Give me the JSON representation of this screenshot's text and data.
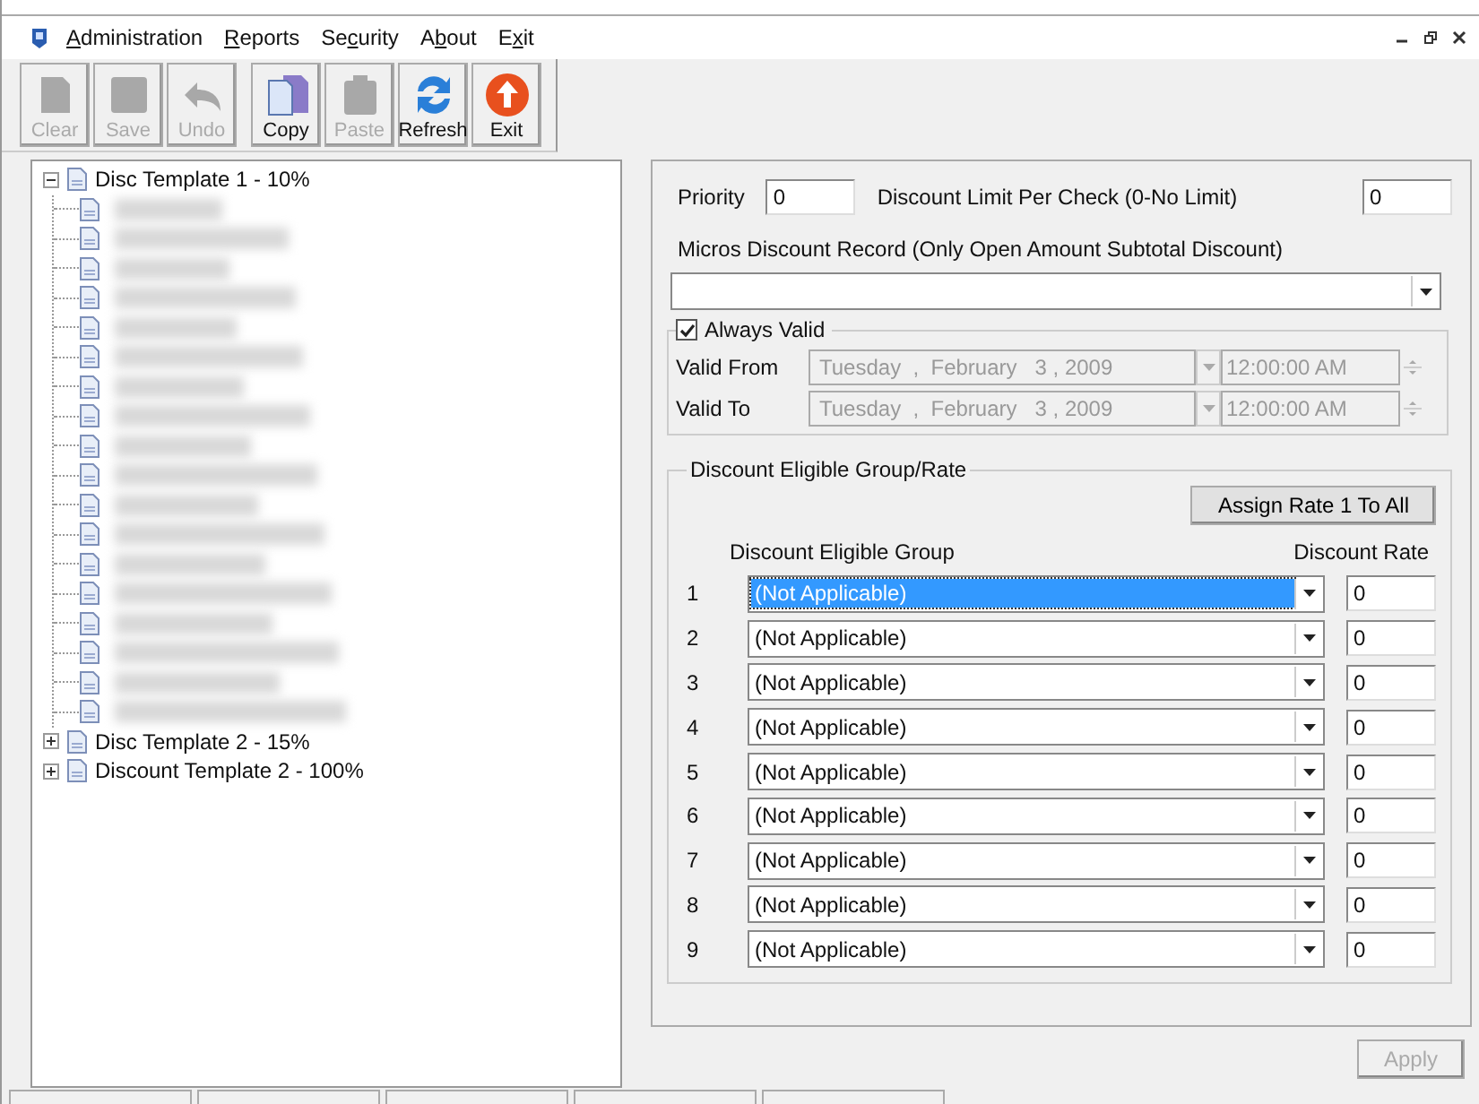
{
  "menu": [
    {
      "access_key": "A",
      "after": "dministration"
    },
    {
      "access_key": "R",
      "after": "eports"
    },
    {
      "before": "Se",
      "access_key": "c",
      "after": "urity"
    },
    {
      "before": "A",
      "access_key": "b",
      "after": "out"
    },
    {
      "before": "E",
      "access_key": "x",
      "after": "it"
    }
  ],
  "toolbar": [
    {
      "label": "Clear",
      "kind": "clear",
      "disabled": true,
      "separator_before": false
    },
    {
      "label": "Save",
      "kind": "save",
      "disabled": true,
      "separator_before": false
    },
    {
      "label": "Undo",
      "kind": "undo",
      "disabled": true,
      "separator_before": false
    },
    {
      "label": "Copy",
      "kind": "copy",
      "disabled": false,
      "separator_before": true
    },
    {
      "label": "Paste",
      "kind": "paste",
      "disabled": true,
      "separator_before": false
    },
    {
      "label": "Refresh",
      "kind": "refresh",
      "disabled": false,
      "separator_before": false
    },
    {
      "label": "Exit",
      "kind": "exit",
      "disabled": false,
      "separator_before": false
    }
  ],
  "tree": [
    {
      "label": "Disc Template 1 - 10%",
      "expanded": true,
      "children": [
        {
          "kind": "redacted"
        },
        {
          "kind": "redacted"
        },
        {
          "kind": "redacted"
        },
        {
          "kind": "redacted"
        },
        {
          "kind": "redacted"
        },
        {
          "kind": "redacted"
        },
        {
          "kind": "redacted"
        },
        {
          "kind": "redacted"
        },
        {
          "kind": "redacted"
        },
        {
          "kind": "redacted"
        },
        {
          "kind": "redacted"
        },
        {
          "kind": "redacted"
        },
        {
          "kind": "redacted"
        },
        {
          "kind": "redacted"
        },
        {
          "kind": "redacted"
        },
        {
          "kind": "redacted"
        },
        {
          "kind": "redacted"
        },
        {
          "kind": "redacted"
        }
      ]
    },
    {
      "label": "Disc Template 2 - 15%",
      "expanded": false
    },
    {
      "label": "Discount Template 2 - 100%",
      "expanded": false
    }
  ],
  "form": {
    "priority_label": "Priority",
    "priority": "0",
    "limit_label": "Discount Limit Per Check (0-No Limit)",
    "limit": "0",
    "record_label": "Micros Discount Record (Only Open Amount Subtotal Discount)",
    "always_valid": {
      "label": "Always Valid",
      "checked": true
    },
    "validity": [
      {
        "label": "Valid From",
        "date": "Tuesday  ,  February   3 , 2009",
        "time": "12:00:00 AM"
      },
      {
        "label": "Valid To",
        "date": "Tuesday  ,  February   3 , 2009",
        "time": "12:00:00 AM"
      }
    ]
  },
  "eligible": {
    "title": "Discount Eligible Group/Rate",
    "assign_button": "Assign Rate 1 To All",
    "group_header": "Discount Eligible Group",
    "rate_header": "Discount Rate",
    "rows": [
      {
        "number": "1",
        "group": "(Not Applicable)",
        "rate": "0",
        "selected": true
      },
      {
        "number": "2",
        "group": "(Not Applicable)",
        "rate": "0",
        "selected": false
      },
      {
        "number": "3",
        "group": "(Not Applicable)",
        "rate": "0",
        "selected": false
      },
      {
        "number": "4",
        "group": "(Not Applicable)",
        "rate": "0",
        "selected": false
      },
      {
        "number": "5",
        "group": "(Not Applicable)",
        "rate": "0",
        "selected": false
      },
      {
        "number": "6",
        "group": "(Not Applicable)",
        "rate": "0",
        "selected": false
      },
      {
        "number": "7",
        "group": "(Not Applicable)",
        "rate": "0",
        "selected": false
      },
      {
        "number": "8",
        "group": "(Not Applicable)",
        "rate": "0",
        "selected": false
      },
      {
        "number": "9",
        "group": "(Not Applicable)",
        "rate": "0",
        "selected": false
      }
    ]
  },
  "apply_button": {
    "label": "Apply",
    "disabled": true
  }
}
